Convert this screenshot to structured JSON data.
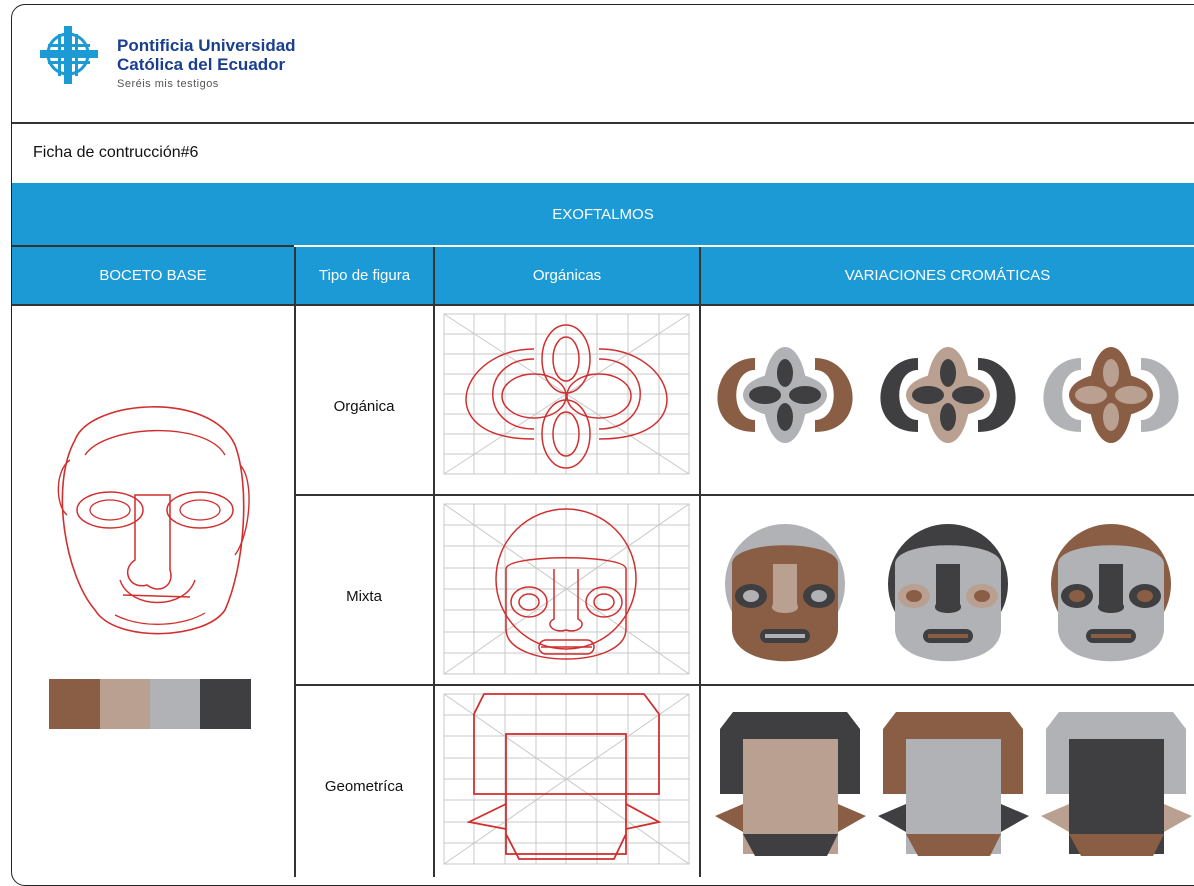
{
  "logo": {
    "line1": "Pontificia Universidad",
    "line2": "Católica del Ecuador",
    "tagline": "Seréis mis testigos",
    "color": "#1b3f8f"
  },
  "ficha_title": "Ficha de contrucción#6",
  "banner_title": "EXOFTALMOS",
  "columns": {
    "boceto": "BOCETO BASE",
    "tipo": "Tipo de figura",
    "organicas": "Orgánicas",
    "variaciones": "VARIACIONES CROMÁTICAS"
  },
  "rows": [
    {
      "label": "Orgánica"
    },
    {
      "label": "Mixta"
    },
    {
      "label": "Geometríca"
    }
  ],
  "palette": [
    "#8a5e45",
    "#b9a091",
    "#b1b2b6",
    "#3f3e41"
  ],
  "colors": {
    "header_blue": "#1b9ad6",
    "sketch_red": "#d12f2f",
    "grid_gray": "#c9c9c9"
  }
}
